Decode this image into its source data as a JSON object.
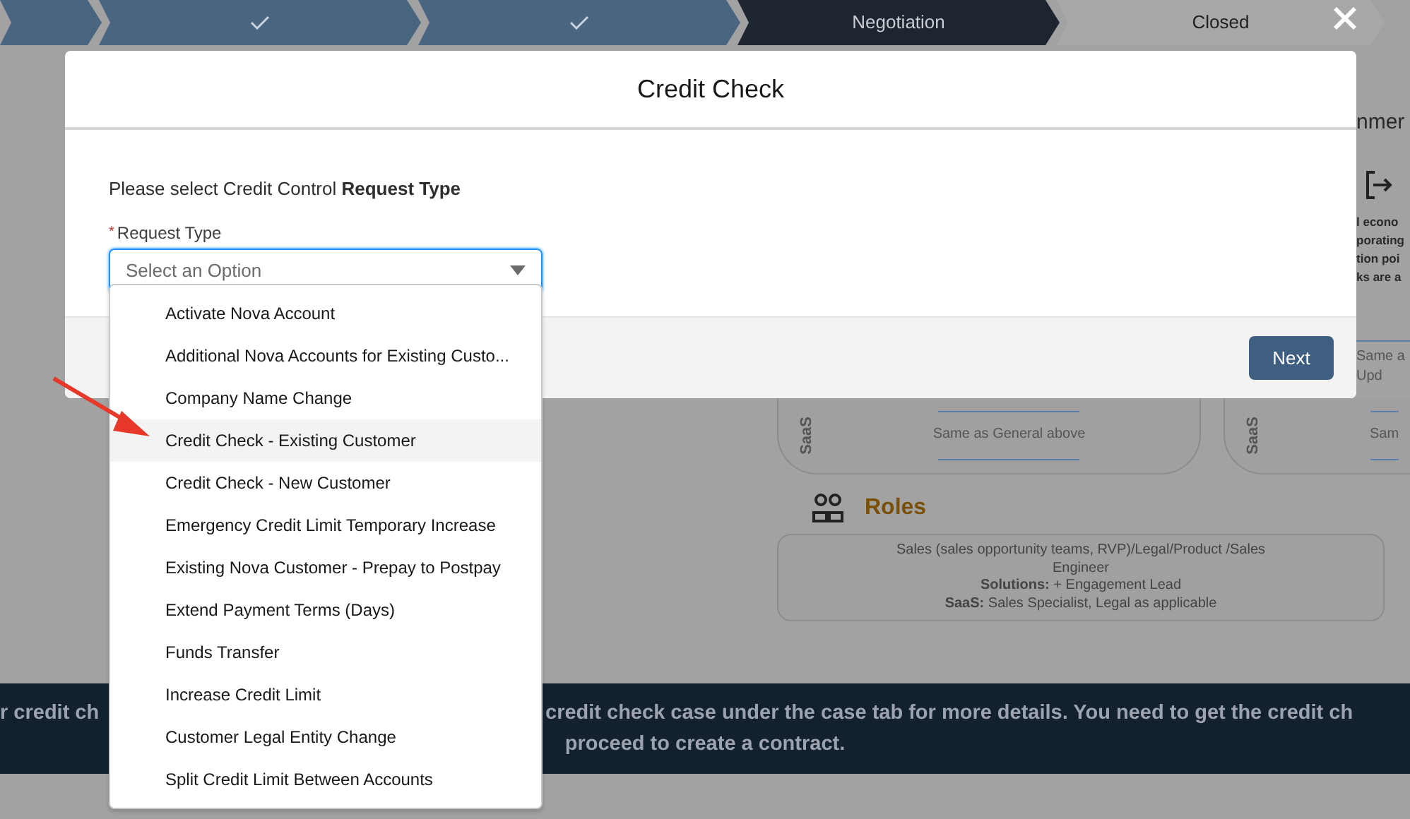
{
  "path": [
    {
      "done": true,
      "current": false,
      "checkmark": false
    },
    {
      "done": true,
      "current": false,
      "checkmark": true
    },
    {
      "done": true,
      "current": false,
      "checkmark": true
    },
    {
      "done": false,
      "current": true,
      "checkmark": false,
      "label": "Negotiation"
    },
    {
      "done": false,
      "current": false,
      "checkmark": false,
      "label": "Closed"
    }
  ],
  "background": {
    "heading_fragment": "nmer",
    "side_text": [
      "l econo",
      "porating",
      "tion poi",
      "ks are a"
    ],
    "card_fragments": [
      "Same a",
      "Upd"
    ],
    "cards": [
      {
        "tag": "SaaS",
        "text": "Same as General above"
      },
      {
        "tag": "SaaS",
        "text": "Sam"
      }
    ],
    "roles": {
      "title": "Roles",
      "lines": [
        "Sales (sales opportunity teams, RVP)/Legal/Product /Sales",
        "Engineer",
        "**Solutions:** + Engagement Lead",
        "**SaaS:** Sales Specialist, Legal as applicable"
      ]
    },
    "banner": {
      "line_1_left": "r credit ch",
      "line_1_right": "credit check case under the case tab for more details. You need to get the credit ch",
      "line_2": "proceed to create a contract."
    }
  },
  "modal": {
    "title": "Credit Check",
    "prompt": "Please select Credit Control **Request Type**",
    "field": {
      "label": "Request Type",
      "required_mark": "*",
      "placeholder": "Select an Option",
      "focused": true
    },
    "options": [
      {
        "label": "Activate Nova Account",
        "highlighted": false
      },
      {
        "label": "Additional Nova Accounts for Existing Custo...",
        "highlighted": false
      },
      {
        "label": "Company Name Change",
        "highlighted": false
      },
      {
        "label": "Credit Check - Existing Customer",
        "highlighted": true
      },
      {
        "label": "Credit Check - New Customer",
        "highlighted": false
      },
      {
        "label": "Emergency Credit Limit Temporary Increase",
        "highlighted": false
      },
      {
        "label": "Existing Nova Customer - Prepay to Postpay",
        "highlighted": false
      },
      {
        "label": "Extend Payment Terms (Days)",
        "highlighted": false
      },
      {
        "label": "Funds Transfer",
        "highlighted": false
      },
      {
        "label": "Increase Credit Limit",
        "highlighted": false
      },
      {
        "label": "Customer Legal Entity Change",
        "highlighted": false
      },
      {
        "label": "Split Credit Limit Between Accounts",
        "highlighted": false
      }
    ],
    "next_button": "Next"
  }
}
